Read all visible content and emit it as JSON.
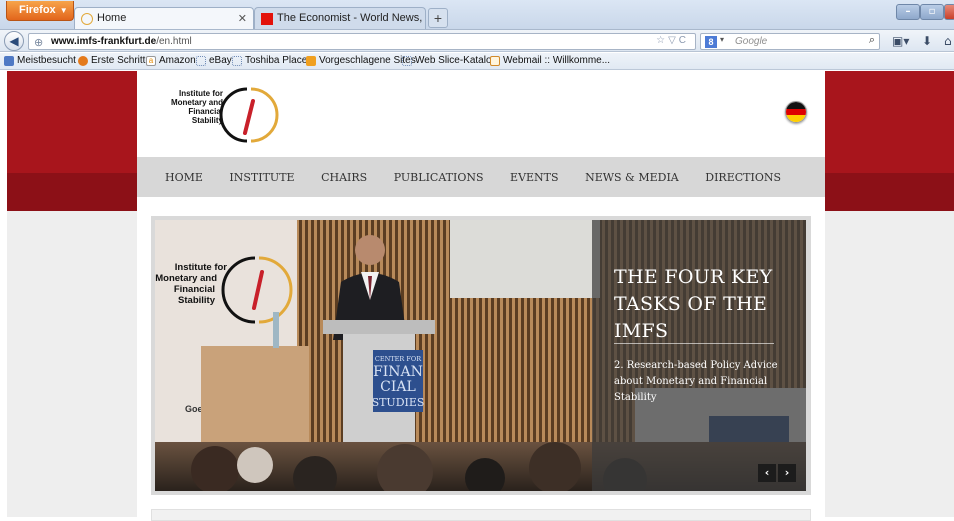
{
  "browser": {
    "firefox_label": "Firefox",
    "tabs": [
      {
        "label": "Home",
        "active": true
      },
      {
        "label": "The Economist - World News, Politics...",
        "active": false
      }
    ],
    "new_tab": "+",
    "url": {
      "host": "www.imfs-frankfurt.de",
      "path": "/en.html"
    },
    "search_placeholder": "Google",
    "bookmarks": [
      {
        "label": "Meistbesucht",
        "icon": "bookmarks-icon"
      },
      {
        "label": "Erste Schritte",
        "icon": "firefox-icon"
      },
      {
        "label": "Amazon",
        "icon": "amazon-icon"
      },
      {
        "label": "eBay",
        "icon": "page-icon"
      },
      {
        "label": "Toshiba Places",
        "icon": "page-icon"
      },
      {
        "label": "Vorgeschlagene Sites",
        "icon": "sites-icon"
      },
      {
        "label": "Web Slice-Katalog",
        "icon": "page-icon"
      },
      {
        "label": "Webmail :: Willkomme...",
        "icon": "mail-icon"
      }
    ]
  },
  "site": {
    "logo_text": [
      "Institute for",
      "Monetary and",
      "Financial",
      "Stability"
    ],
    "language_flag": "german-flag-icon",
    "nav": [
      "HOME",
      "INSTITUTE",
      "CHAIRS",
      "PUBLICATIONS",
      "EVENTS",
      "NEWS & MEDIA",
      "DIRECTIONS"
    ],
    "slide": {
      "title": "THE FOUR KEY TASKS OF THE IMFS",
      "text": "2. Research-based Policy Advice about Monetary and Financial Stability",
      "prev": "‹",
      "next": "›",
      "lectern_text": [
        "CENTER FOR",
        "FINAN",
        "CIAL",
        "STUDIES"
      ],
      "banner_text": [
        "Institute for",
        "Monetary and",
        "Financial",
        "Stability"
      ],
      "banner_partial": "Goe"
    },
    "colors": {
      "brand_red": "#a8151c",
      "nav_grey": "#d7d7d7",
      "logo_gold": "#e2a93a"
    }
  }
}
